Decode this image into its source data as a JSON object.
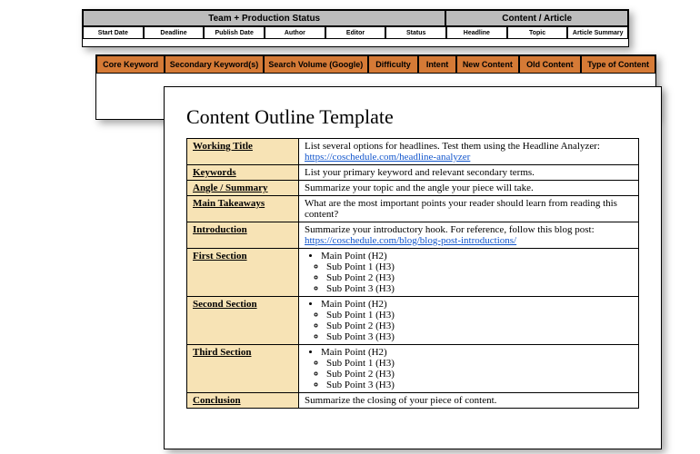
{
  "back": {
    "groupA": "Team + Production Status",
    "groupB": "Content / Article",
    "cols": [
      "Start Date",
      "Deadline",
      "Publish Date",
      "Author",
      "Editor",
      "Status",
      "Headline",
      "Topic",
      "Article Summary"
    ]
  },
  "mid": {
    "cols": [
      "Core Keyword",
      "Secondary Keyword(s)",
      "Search Volume (Google)",
      "Difficulty",
      "Intent",
      "New Content",
      "Old Content",
      "Type of Content"
    ]
  },
  "front": {
    "title": "Content Outline Template",
    "rows": [
      {
        "label": "Working Title",
        "text": "List several options for headlines. Test them using the Headline Analyzer: ",
        "link": "https://coschedule.com/headline-analyzer"
      },
      {
        "label": "Keywords",
        "text": "List your primary keyword and relevant secondary terms."
      },
      {
        "label": "Angle / Summary",
        "text": "Summarize your topic and the angle your piece will take."
      },
      {
        "label": "Main Takeaways",
        "text": "What are the most important points your reader should learn from reading this content?"
      },
      {
        "label": "Introduction",
        "text": "Summarize your introductory hook. For reference, follow this blog post: ",
        "link": "https://coschedule.com/blog/blog-post-introductions/"
      }
    ],
    "sections": [
      {
        "label": "First Section",
        "main": "Main Point (H2)",
        "subs": [
          "Sub Point 1 (H3)",
          "Sub Point 2 (H3)",
          "Sub Point 3 (H3)"
        ]
      },
      {
        "label": "Second Section",
        "main": "Main Point (H2)",
        "subs": [
          "Sub Point 1 (H3)",
          "Sub Point 2 (H3)",
          "Sub Point 3 (H3)"
        ]
      },
      {
        "label": "Third Section",
        "main": "Main Point (H2)",
        "subs": [
          "Sub Point 1 (H3)",
          "Sub Point 2 (H3)",
          "Sub Point 3 (H3)"
        ]
      }
    ],
    "conclusion": {
      "label": "Conclusion",
      "text": "Summarize the closing of your piece of content."
    }
  }
}
